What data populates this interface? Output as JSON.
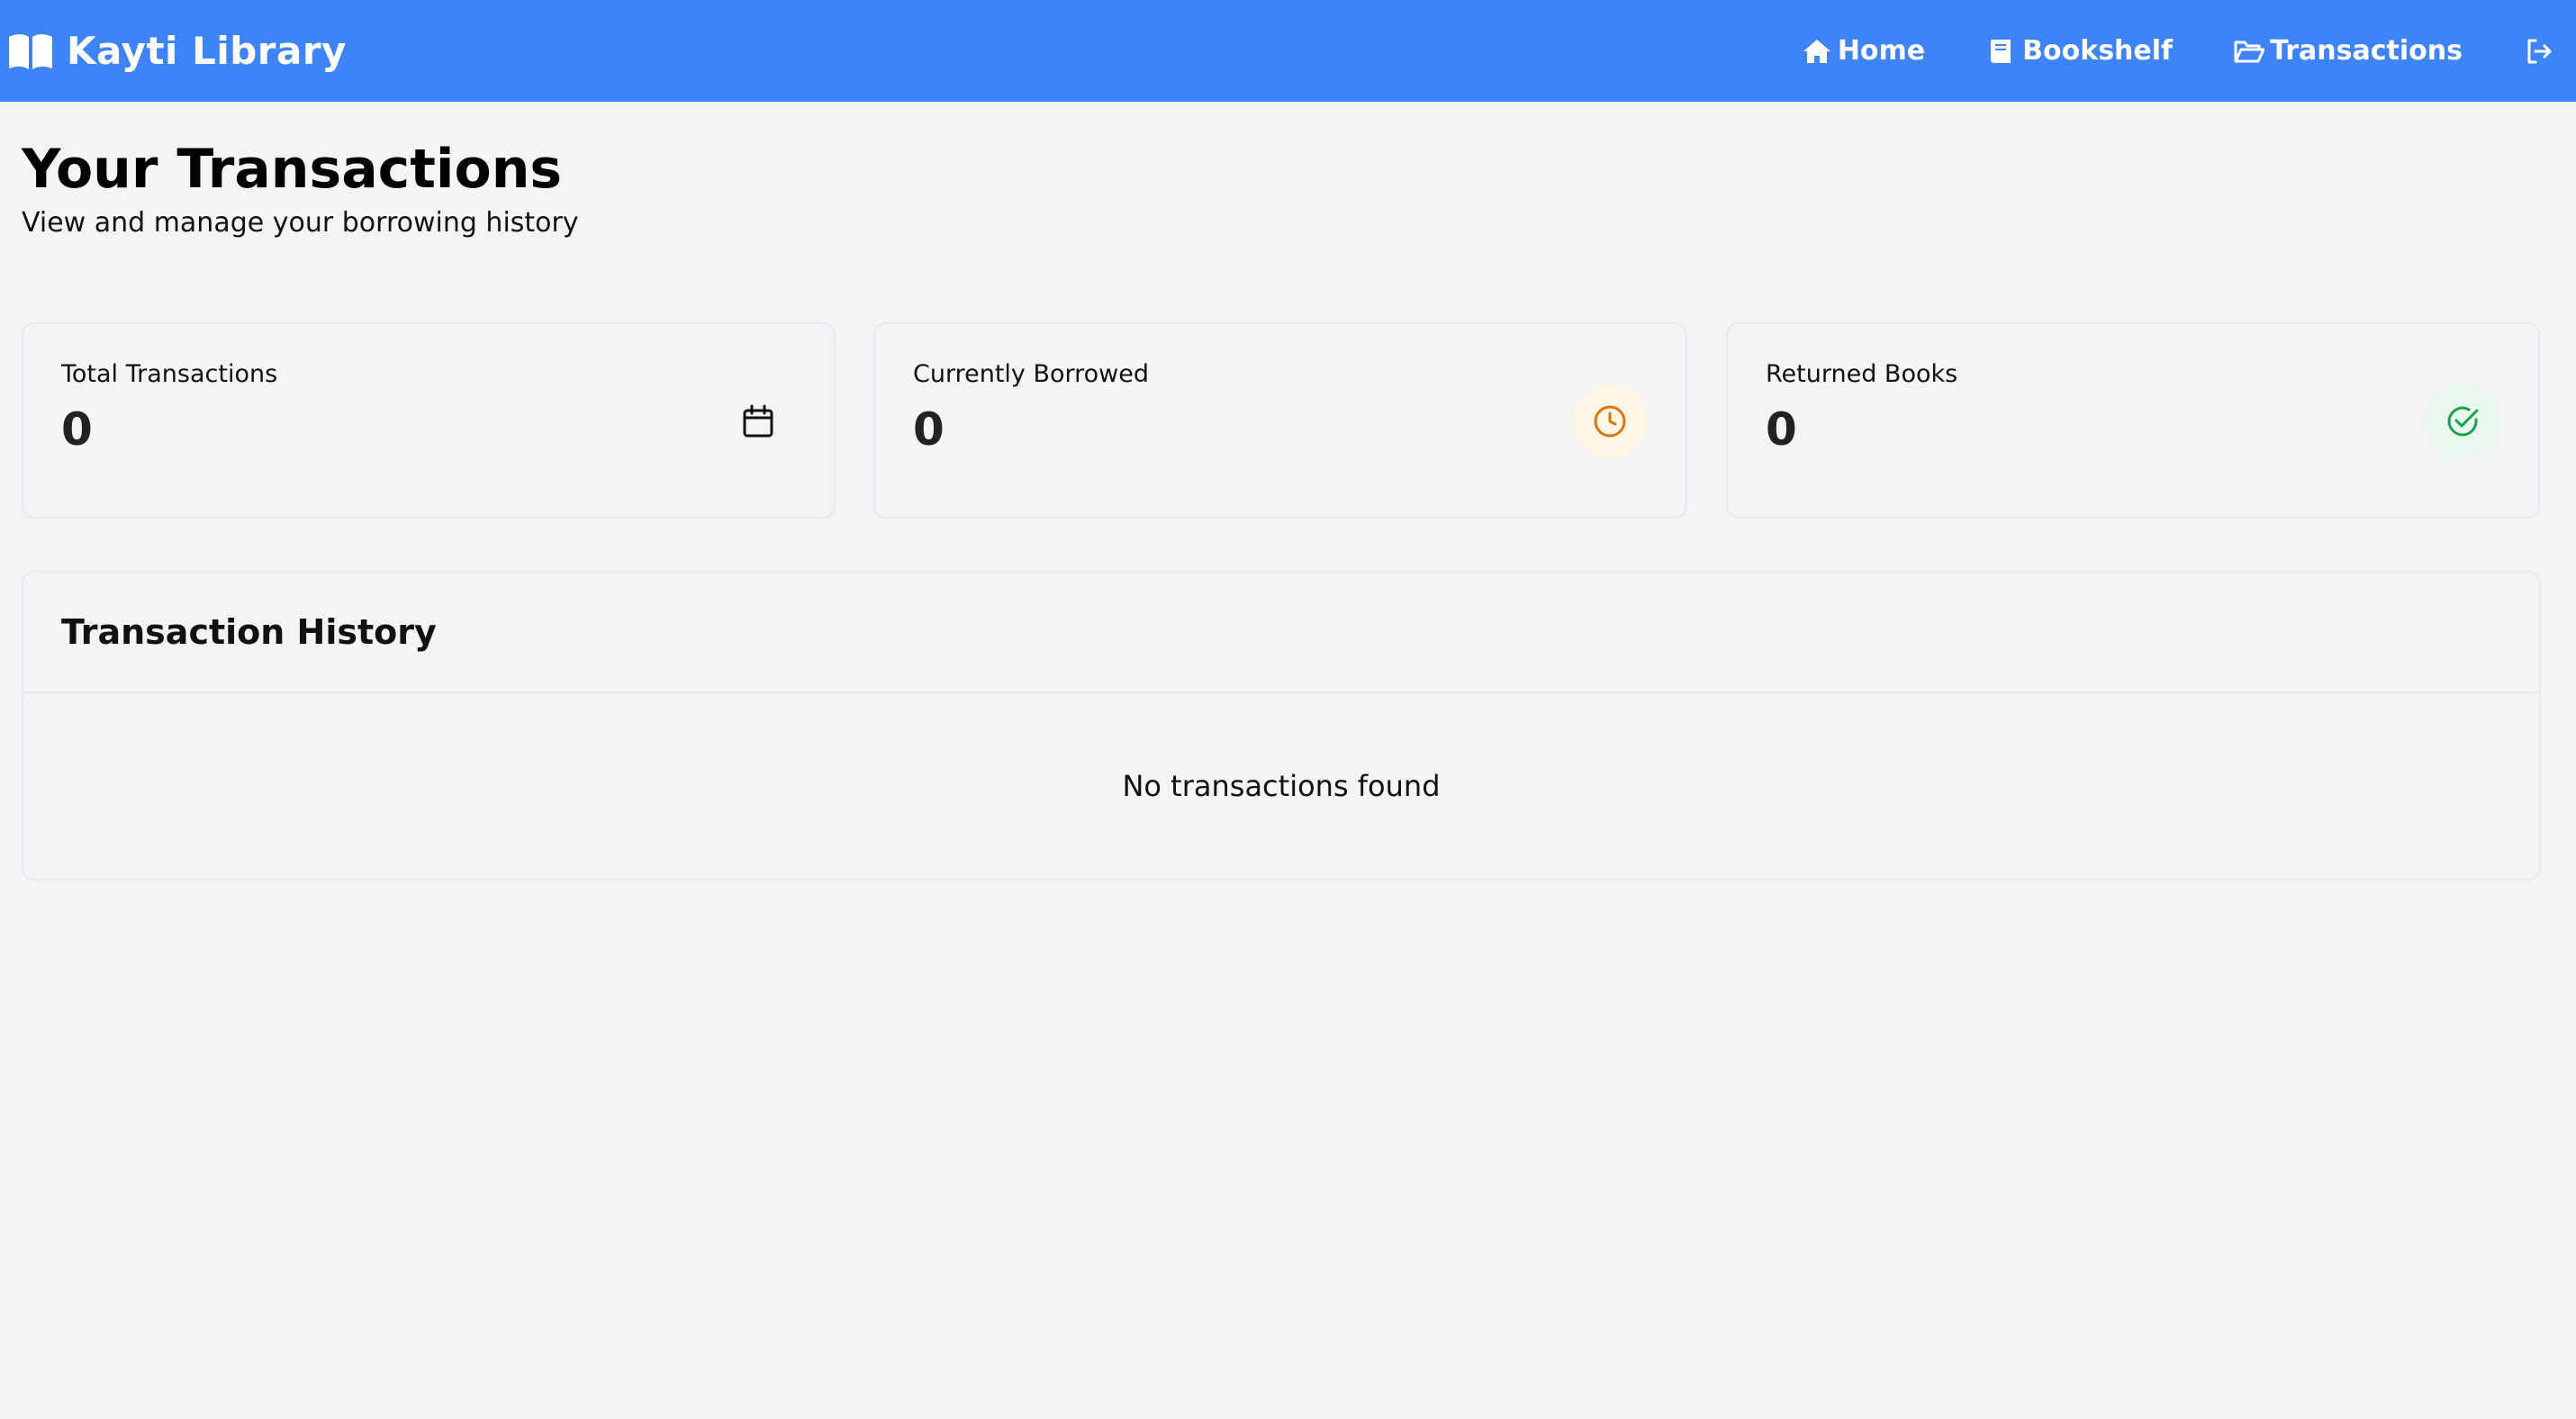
{
  "navbar": {
    "brand": "Kayti Library",
    "brand_icon": "open-book-icon",
    "background_color": "#3f83f8",
    "links": [
      {
        "label": "Home",
        "icon": "home-icon"
      },
      {
        "label": "Bookshelf",
        "icon": "book-icon"
      },
      {
        "label": "Transactions",
        "icon": "folder-open-icon"
      }
    ],
    "logout_icon": "logout-icon"
  },
  "header": {
    "title": "Your Transactions",
    "subtitle": "View and manage your borrowing history"
  },
  "stats": [
    {
      "label": "Total Transactions",
      "value": "0",
      "icon": "calendar-icon",
      "icon_color": "#111111",
      "icon_bg": "transparent"
    },
    {
      "label": "Currently Borrowed",
      "value": "0",
      "icon": "clock-icon",
      "icon_color": "#d97706",
      "icon_bg": "#fef6e4"
    },
    {
      "label": "Returned Books",
      "value": "0",
      "icon": "check-circle-icon",
      "icon_color": "#16a34a",
      "icon_bg": "#eaf7ee"
    }
  ],
  "history": {
    "title": "Transaction History",
    "empty_message": "No transactions found"
  }
}
